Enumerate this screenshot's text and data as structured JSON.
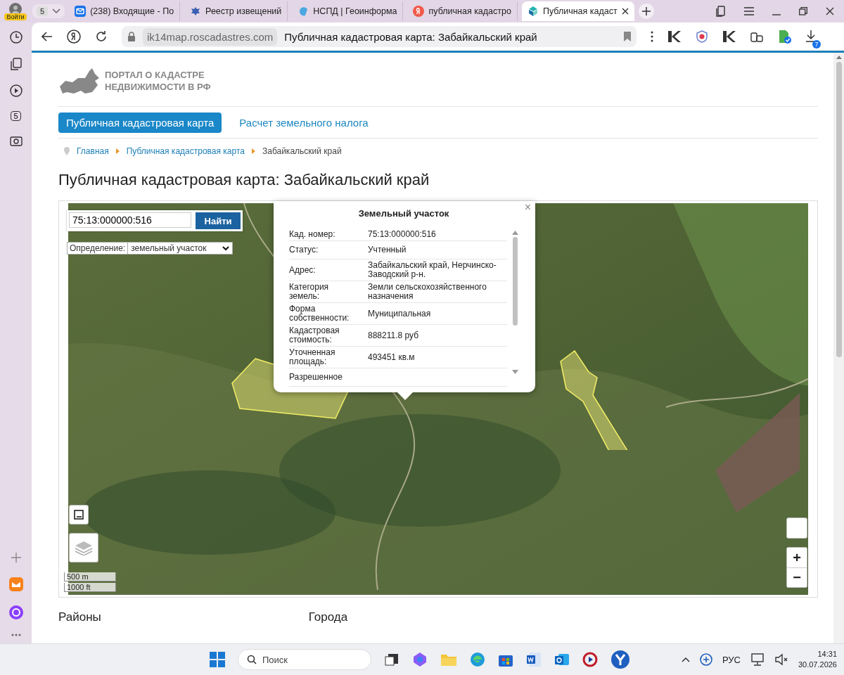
{
  "browser": {
    "login": "Войти",
    "tab_count": "5",
    "tabs": [
      {
        "kind": "mail",
        "title": "(238) Входящие - По",
        "selected": false
      },
      {
        "kind": "emblem",
        "title": "Реестр извещений",
        "selected": false
      },
      {
        "kind": "nspd",
        "title": "НСПД | Геоинформа",
        "selected": false
      },
      {
        "kind": "yandex",
        "title": "публичная кадастро",
        "selected": false
      },
      {
        "kind": "cadastre",
        "title": "Публичная кадаст",
        "selected": true
      }
    ],
    "address": "ik14map.roscadastres.com",
    "page_title": "Публичная кадастровая карта: Забайкальский край",
    "downloads_badge": "7",
    "rail_badge": "5"
  },
  "site": {
    "logo": [
      "ПОРТАЛ О КАДАСТРЕ",
      "НЕДВИЖИМОСТИ В РФ"
    ],
    "nav": [
      {
        "label": "Публичная кадастровая карта",
        "selected": true
      },
      {
        "label": "Расчет земельного налога",
        "selected": false
      }
    ],
    "breadcrumbs": [
      "Главная",
      "Публичная кадастровая карта",
      "Забайкальский край"
    ],
    "heading": "Публичная кадастровая карта: Забайкальский край",
    "map": {
      "search": {
        "value": "75:13:000000:516",
        "button": "Найти"
      },
      "mode": {
        "label": "Определение:",
        "value": "земельный участок"
      },
      "popup": {
        "title": "Земельный участок",
        "close": "×",
        "rows": [
          {
            "label": "Кад. номер:",
            "value": "75:13:000000:516"
          },
          {
            "label": "Статус:",
            "value": "Учтенный"
          },
          {
            "label": "Адрес:",
            "value": "Забайкальский край, Нерчинско-Заводский р-н."
          },
          {
            "label": "Категория земель:",
            "value": "Земли сельскохозяйственного назначения"
          },
          {
            "label": "Форма собственности:",
            "value": "Муниципальная"
          },
          {
            "label": "Кадастровая стоимость:",
            "value": "888211.8 руб"
          },
          {
            "label": "Уточненная площадь:",
            "value": "493451 кв.м"
          },
          {
            "label": "Разрешенное"
          }
        ]
      },
      "scale": [
        "500 m",
        "1000 ft"
      ],
      "zoom": [
        "+",
        "−"
      ]
    },
    "sections": [
      "Районы",
      "Города"
    ]
  },
  "taskbar": {
    "search": "Поиск",
    "language": "РУС",
    "time": "14:31",
    "date": "30.07.2026"
  }
}
